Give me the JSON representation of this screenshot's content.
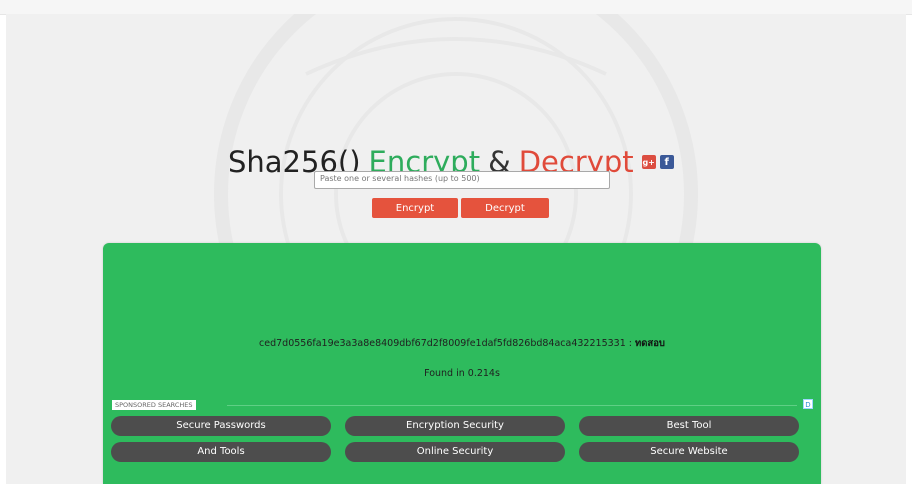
{
  "headline": {
    "part_func": "Sha256()",
    "part_encrypt": "Encrypt",
    "part_amp": "&",
    "part_decrypt": "Decrypt"
  },
  "social": {
    "gplus_glyph": "g+",
    "facebook_glyph": "f"
  },
  "form": {
    "hash_placeholder": "Paste one or several hashes (up to 500)",
    "hash_value": "",
    "encrypt_label": "Encrypt",
    "decrypt_label": "Decrypt"
  },
  "result": {
    "hash": "ced7d0556fa19e3a3a8e8409dbf67d2f8009fe1daf5fd826bd84aca432215331",
    "separator": " : ",
    "plaintext": "ทดสอบ",
    "found_text": "Found in 0.214s"
  },
  "sponsored": {
    "label": "SPONSORED SEARCHES",
    "ad_choice_glyph": "D",
    "links": [
      "Secure Passwords",
      "Encryption Security",
      "Best Tool",
      "And Tools",
      "Online Security",
      "Secure Website"
    ]
  },
  "colors": {
    "green_result": "#2ebb5d",
    "button_red": "#e5533d",
    "title_green": "#2eac5c",
    "title_red": "#e04a3a",
    "pill_gray": "#4d4d4d"
  }
}
